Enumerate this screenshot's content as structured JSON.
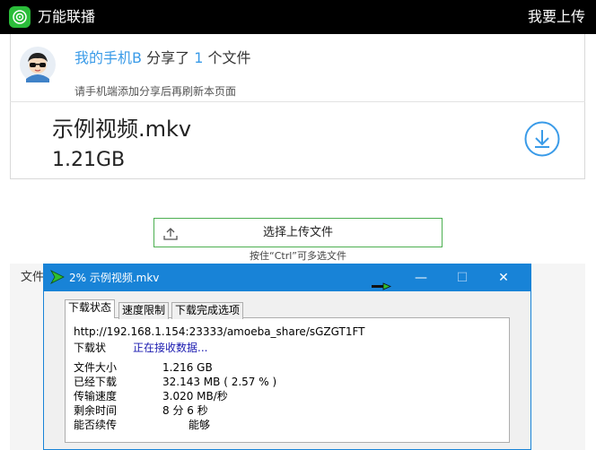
{
  "header": {
    "app_title": "万能联播",
    "upload_link": "我要上传"
  },
  "share": {
    "device_name": "我的手机B",
    "shared_text": "分享了",
    "file_count": "1",
    "files_unit": "个文件",
    "hint": "请手机端添加分享后再刷新本页面",
    "file_name": "示例视频.mkv",
    "file_size": "1.21GB"
  },
  "upload": {
    "select_button": "选择上传文件",
    "multi_hint": "按住“Ctrl”可多选文件"
  },
  "files_section": {
    "label": "文件"
  },
  "dialog": {
    "title": "2% 示例视频.mkv",
    "controls": {
      "minimize": "—",
      "maximize": "☐",
      "close": "✕"
    },
    "tabs": [
      {
        "label": "下载状态"
      },
      {
        "label": "速度限制"
      },
      {
        "label": "下载完成选项"
      }
    ],
    "url": "http://192.168.1.154:23333/amoeba_share/sGZGT1FT",
    "status_label": "下载状",
    "status_value": "正在接收数据...",
    "rows": [
      {
        "label": "文件大小",
        "value": "1.216  GB"
      },
      {
        "label": "已经下载",
        "value": "32.143  MB  ( 2.57 % )"
      },
      {
        "label": "传输速度",
        "value": "3.020  MB/秒"
      },
      {
        "label": "剩余时间",
        "value": "8 分 6 秒"
      },
      {
        "label": "能否续传",
        "value": "能够"
      }
    ]
  },
  "colors": {
    "accent": "#3a9be8",
    "titlebar": "#1883d7",
    "logo": "#2bbd3a",
    "button_border": "#4caf50"
  }
}
